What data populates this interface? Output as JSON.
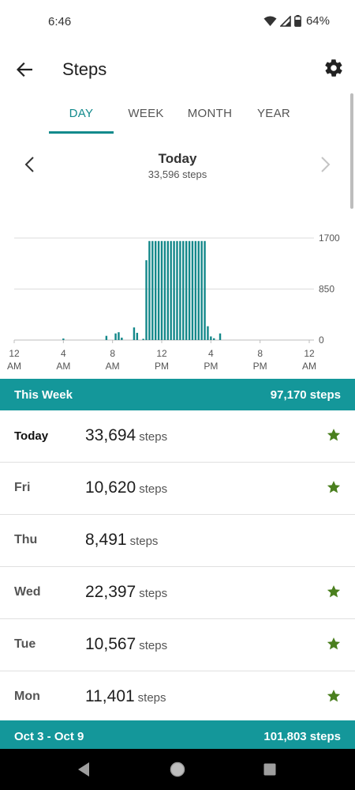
{
  "status": {
    "time": "6:46",
    "battery": "64%",
    "icons": [
      "wifi-icon",
      "signal-icon",
      "battery-icon"
    ]
  },
  "app_bar": {
    "title": "Steps",
    "back_icon": "arrow-back-icon",
    "settings_icon": "gear-icon"
  },
  "tabs": [
    {
      "label": "DAY",
      "active": true
    },
    {
      "label": "WEEK",
      "active": false
    },
    {
      "label": "MONTH",
      "active": false
    },
    {
      "label": "YEAR",
      "active": false
    }
  ],
  "date_nav": {
    "title": "Today",
    "subtitle": "33,596 steps"
  },
  "chart_data": {
    "type": "bar",
    "ylim": [
      0,
      1700
    ],
    "yticks": [
      "1700",
      "850",
      "0"
    ],
    "xticks": [
      {
        "line1": "12",
        "line2": "AM"
      },
      {
        "line1": "4",
        "line2": "AM"
      },
      {
        "line1": "8",
        "line2": "AM"
      },
      {
        "line1": "12",
        "line2": "PM"
      },
      {
        "line1": "4",
        "line2": "PM"
      },
      {
        "line1": "8",
        "line2": "PM"
      },
      {
        "line1": "12",
        "line2": "AM"
      }
    ],
    "grid": true,
    "x_unit": "hour of day",
    "bars": [
      {
        "x": 4.0,
        "value": 25
      },
      {
        "x": 7.5,
        "value": 70
      },
      {
        "x": 8.25,
        "value": 110
      },
      {
        "x": 8.5,
        "value": 130
      },
      {
        "x": 8.75,
        "value": 40
      },
      {
        "x": 9.75,
        "value": 210
      },
      {
        "x": 10.0,
        "value": 120
      },
      {
        "x": 10.5,
        "value": 20
      },
      {
        "x": 10.75,
        "value": 1330
      },
      {
        "x": 11.0,
        "value": 1650
      },
      {
        "x": 11.25,
        "value": 1650
      },
      {
        "x": 11.5,
        "value": 1650
      },
      {
        "x": 11.75,
        "value": 1650
      },
      {
        "x": 12.0,
        "value": 1650
      },
      {
        "x": 12.25,
        "value": 1650
      },
      {
        "x": 12.5,
        "value": 1650
      },
      {
        "x": 12.75,
        "value": 1650
      },
      {
        "x": 13.0,
        "value": 1650
      },
      {
        "x": 13.25,
        "value": 1650
      },
      {
        "x": 13.5,
        "value": 1650
      },
      {
        "x": 13.75,
        "value": 1650
      },
      {
        "x": 14.0,
        "value": 1650
      },
      {
        "x": 14.25,
        "value": 1650
      },
      {
        "x": 14.5,
        "value": 1650
      },
      {
        "x": 14.75,
        "value": 1650
      },
      {
        "x": 15.0,
        "value": 1650
      },
      {
        "x": 15.25,
        "value": 1650
      },
      {
        "x": 15.5,
        "value": 1650
      },
      {
        "x": 15.75,
        "value": 230
      },
      {
        "x": 16.0,
        "value": 60
      },
      {
        "x": 16.25,
        "value": 30
      },
      {
        "x": 16.75,
        "value": 110
      }
    ],
    "bar_color": "#14888a",
    "grid_color": "#dcdcdc"
  },
  "this_week": {
    "label": "This Week",
    "total": "97,170 steps"
  },
  "days": [
    {
      "name": "Today",
      "steps": "33,694",
      "unit": "steps",
      "star": true
    },
    {
      "name": "Fri",
      "steps": "10,620",
      "unit": "steps",
      "star": true
    },
    {
      "name": "Thu",
      "steps": "8,491",
      "unit": "steps",
      "star": false
    },
    {
      "name": "Wed",
      "steps": "22,397",
      "unit": "steps",
      "star": true
    },
    {
      "name": "Tue",
      "steps": "10,567",
      "unit": "steps",
      "star": true
    },
    {
      "name": "Mon",
      "steps": "11,401",
      "unit": "steps",
      "star": true
    }
  ],
  "prev_week": {
    "label": "Oct 3 - Oct 9",
    "total": "101,803 steps"
  },
  "colors": {
    "accent": "#128a8c",
    "header_bg": "#14979a",
    "star": "#4a7f1e"
  }
}
